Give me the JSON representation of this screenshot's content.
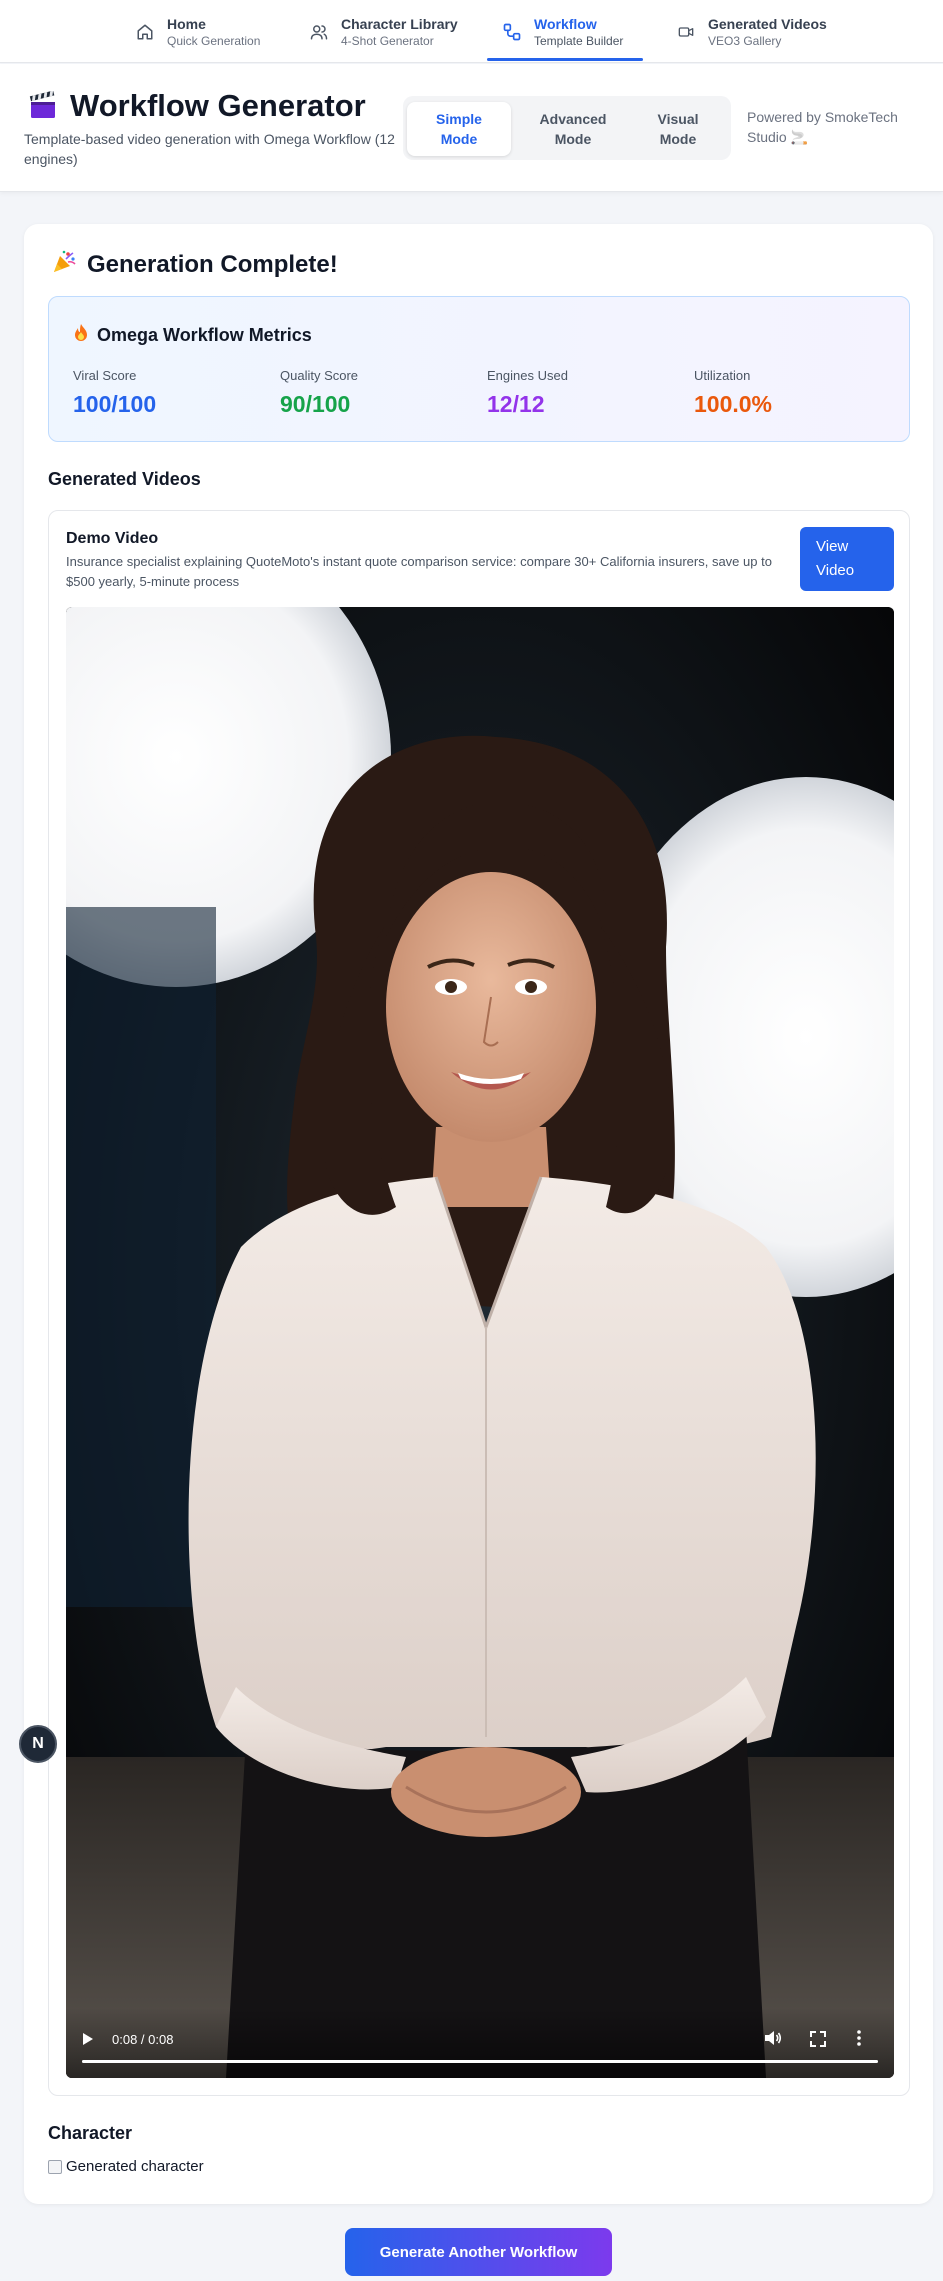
{
  "nav": {
    "items": [
      {
        "label": "Home",
        "sub": "Quick Generation",
        "icon": "home-icon"
      },
      {
        "label": "Character Library",
        "sub": "4-Shot Generator",
        "icon": "users-icon"
      },
      {
        "label": "Workflow",
        "sub": "Template Builder",
        "icon": "workflow-icon",
        "active": true
      },
      {
        "label": "Generated Videos",
        "sub": "VEO3 Gallery",
        "icon": "video-camera-icon"
      }
    ]
  },
  "header": {
    "title": "Workflow Generator",
    "subtitle": "Template-based video generation with Omega Workflow (12 engines)",
    "modes": [
      {
        "label": "Simple Mode",
        "active": true
      },
      {
        "label": "Advanced Mode"
      },
      {
        "label": "Visual Mode"
      }
    ],
    "powered_by": "Powered by SmokeTech Studio 🚬"
  },
  "result": {
    "title": "Generation Complete!",
    "metrics_title": "Omega Workflow Metrics",
    "metrics": [
      {
        "label": "Viral Score",
        "value": "100/100",
        "color": "#2563eb"
      },
      {
        "label": "Quality Score",
        "value": "90/100",
        "color": "#16a34a"
      },
      {
        "label": "Engines Used",
        "value": "12/12",
        "color": "#9333ea"
      },
      {
        "label": "Utilization",
        "value": "100.0%",
        "color": "#ea580c"
      }
    ],
    "videos_title": "Generated Videos",
    "video": {
      "title": "Demo Video",
      "description": "Insurance specialist explaining QuoteMoto's instant quote comparison service: compare 30+ California insurers, save up to $500 yearly, 5-minute process",
      "view_button": "View Video",
      "time": "0:08 / 0:08",
      "progress": 1.0
    },
    "character_title": "Character",
    "character_alt": "Generated character"
  },
  "badge": "N",
  "footer": {
    "generate_button": "Generate Another Workflow"
  }
}
